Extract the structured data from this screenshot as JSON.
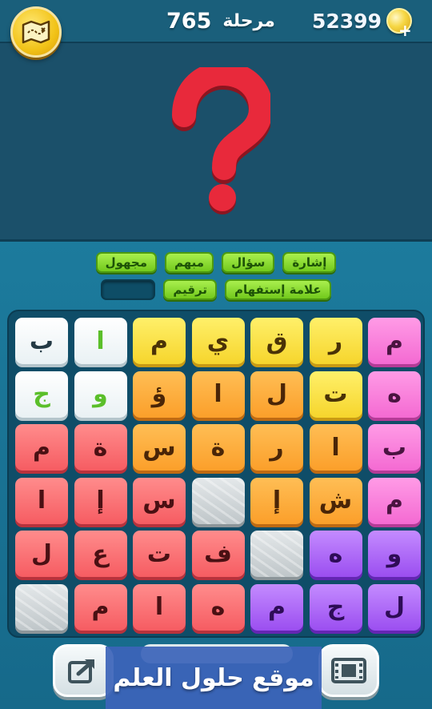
{
  "header": {
    "level_label": "مرحلة",
    "level_number": "765",
    "coins": "52399"
  },
  "icons": {
    "menu": "map-scroll-icon",
    "coins": "gold-coin-icon",
    "add_coins": "plus-icon",
    "share": "share-icon",
    "video": "film-icon"
  },
  "hints": {
    "row1": [
      "إشارة",
      "سؤال",
      "مبهم",
      "مجهول"
    ],
    "row2": [
      "علامة إستفهام",
      "ترقيم",
      ""
    ]
  },
  "grid": {
    "rows": [
      [
        {
          "l": "م",
          "c": "pink"
        },
        {
          "l": "ر",
          "c": "yellow"
        },
        {
          "l": "ق",
          "c": "yellow"
        },
        {
          "l": "ي",
          "c": "yellow"
        },
        {
          "l": "م",
          "c": "yellow"
        },
        {
          "l": "ا",
          "c": "white",
          "green": true
        },
        {
          "l": "ب",
          "c": "white"
        }
      ],
      [
        {
          "l": "ه",
          "c": "pink"
        },
        {
          "l": "ت",
          "c": "yellow"
        },
        {
          "l": "ل",
          "c": "orange"
        },
        {
          "l": "ا",
          "c": "orange"
        },
        {
          "l": "ؤ",
          "c": "orange"
        },
        {
          "l": "و",
          "c": "white",
          "green": true
        },
        {
          "l": "ج",
          "c": "white",
          "green": true
        }
      ],
      [
        {
          "l": "ب",
          "c": "pink"
        },
        {
          "l": "ا",
          "c": "orange"
        },
        {
          "l": "ر",
          "c": "orange"
        },
        {
          "l": "ة",
          "c": "orange"
        },
        {
          "l": "س",
          "c": "orange"
        },
        {
          "l": "ة",
          "c": "red"
        },
        {
          "l": "م",
          "c": "red"
        }
      ],
      [
        {
          "l": "م",
          "c": "pink"
        },
        {
          "l": "ش",
          "c": "orange"
        },
        {
          "l": "إ",
          "c": "orange"
        },
        {
          "l": "",
          "c": "stone"
        },
        {
          "l": "س",
          "c": "red"
        },
        {
          "l": "إ",
          "c": "red"
        },
        {
          "l": "ا",
          "c": "red"
        }
      ],
      [
        {
          "l": "و",
          "c": "purple"
        },
        {
          "l": "ه",
          "c": "purple"
        },
        {
          "l": "",
          "c": "stone"
        },
        {
          "l": "ف",
          "c": "red"
        },
        {
          "l": "ت",
          "c": "red"
        },
        {
          "l": "ع",
          "c": "red"
        },
        {
          "l": "ل",
          "c": "red"
        }
      ],
      [
        {
          "l": "ل",
          "c": "purple"
        },
        {
          "l": "ج",
          "c": "purple"
        },
        {
          "l": "م",
          "c": "purple"
        },
        {
          "l": "ه",
          "c": "red"
        },
        {
          "l": "ا",
          "c": "red"
        },
        {
          "l": "م",
          "c": "red"
        },
        {
          "l": "",
          "c": "stone"
        }
      ]
    ]
  },
  "watermark": "موقع حلول العلم",
  "colors": {
    "accent_green": "#72c91c",
    "background": "#14506a",
    "question_mark": "#e8293b"
  }
}
